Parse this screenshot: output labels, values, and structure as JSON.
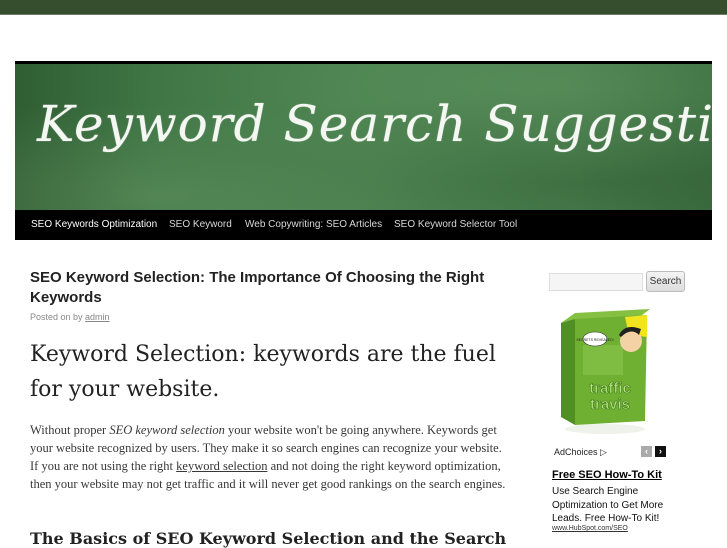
{
  "site": {
    "banner_title": "Keyword Search Suggestion"
  },
  "nav": {
    "items": [
      {
        "label": "SEO Keywords Optimization",
        "active": true
      },
      {
        "label": "SEO Keyword",
        "active": false
      },
      {
        "label": "Web Copywriting: SEO Articles",
        "active": false
      },
      {
        "label": "SEO Keyword Selector Tool",
        "active": false
      }
    ]
  },
  "post": {
    "title": "SEO Keyword Selection: The Importance Of Choosing the Right Keywords",
    "posted_prefix": "Posted on by ",
    "author": "admin",
    "subheading": "Keyword Selection: keywords are the fuel for your website.",
    "para_parts": {
      "p1": "Without proper ",
      "em": "SEO keyword selection",
      "p2": " your website won't be going anywhere. Keywords get your website recognized by users. They make it so search engines can recognize your website. If you are not using the right ",
      "link": "keyword selection",
      "p3": " and not doing the right keyword optimization, then your website may not get traffic and it will never get good rankings on the search engines."
    },
    "subheading2": "The Basics of SEO Keyword Selection and the Search"
  },
  "sidebar": {
    "search_value": "",
    "search_button": "Search",
    "product_label": "traffic travis",
    "product_bubble": "SECRETS REVEALED!"
  },
  "ad": {
    "adchoices": "AdChoices",
    "prev_icon": "‹",
    "next_icon": "›",
    "title": "Free SEO How-To Kit",
    "body": "Use Search Engine Optimization to Get More Leads. Free How-To Kit!",
    "url": "www.HubSpot.com/SEO"
  },
  "colors": {
    "topbar": "#364d2e",
    "nav_bg": "#000000",
    "banner_green": "#4a8250"
  }
}
